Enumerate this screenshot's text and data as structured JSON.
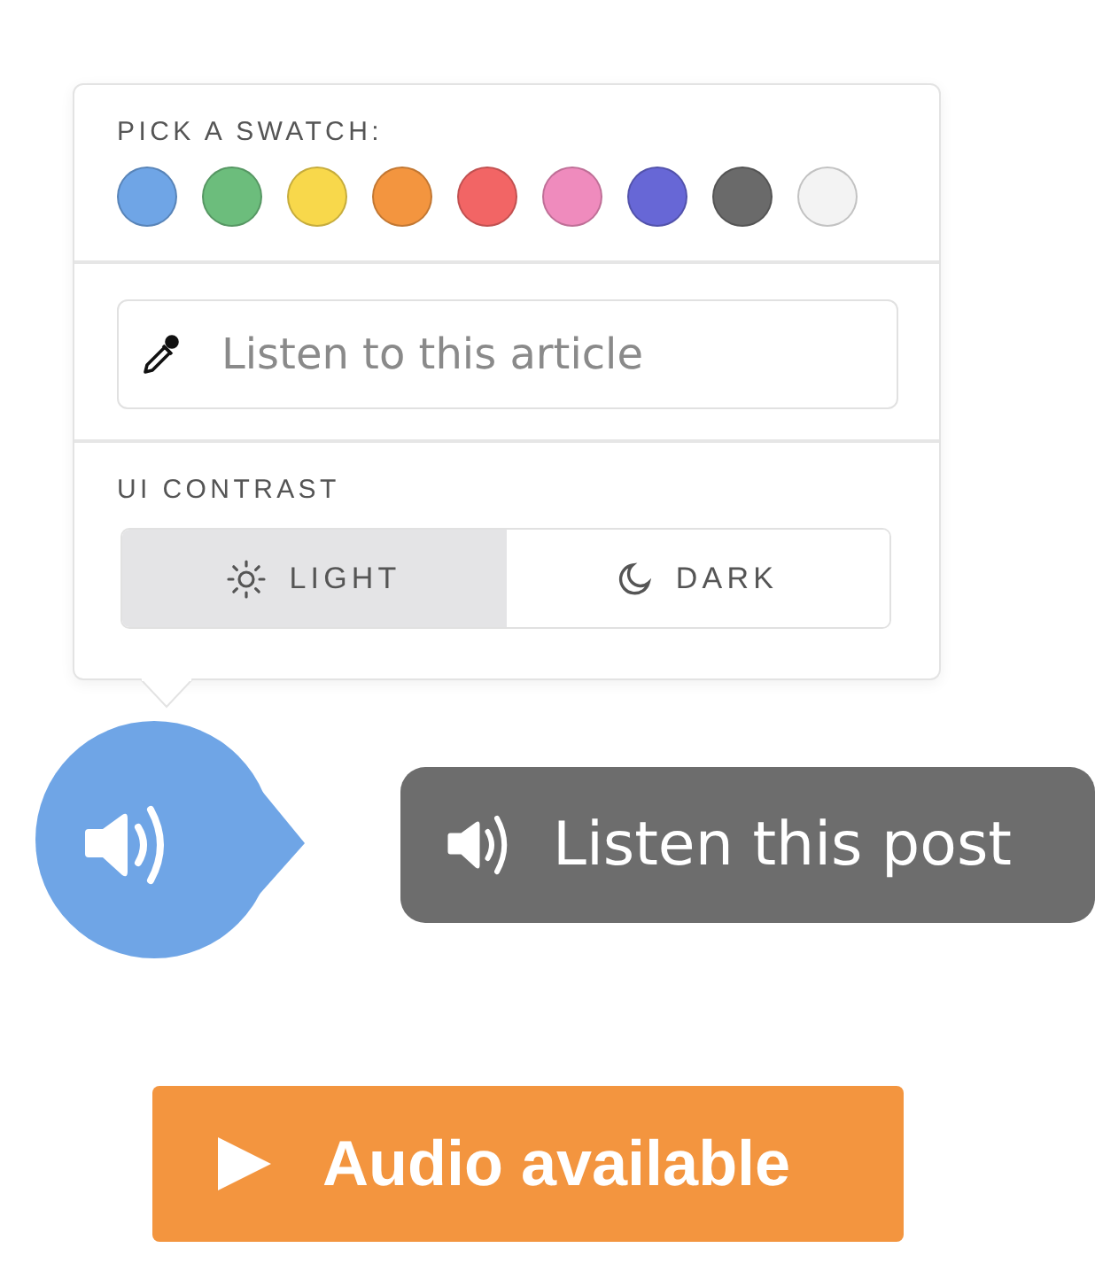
{
  "popover": {
    "swatch_label": "PICK A SWATCH:",
    "swatches": [
      {
        "color": "#6fa5e6"
      },
      {
        "color": "#6cbd7c"
      },
      {
        "color": "#f8d84b"
      },
      {
        "color": "#f3953f"
      },
      {
        "color": "#f26565"
      },
      {
        "color": "#ef8bbd"
      },
      {
        "color": "#6767d6"
      },
      {
        "color": "#6a6a6a"
      },
      {
        "color": "#f3f3f3"
      }
    ],
    "title_field": {
      "placeholder": "Listen to this article"
    },
    "contrast_label": "UI CONTRAST",
    "contrast_options": [
      {
        "kind": "light",
        "label": "LIGHT",
        "selected": true
      },
      {
        "kind": "dark",
        "label": "DARK",
        "selected": false
      }
    ]
  },
  "listen_button": {
    "label": "Listen this post"
  },
  "audio_button": {
    "label": "Audio available"
  }
}
